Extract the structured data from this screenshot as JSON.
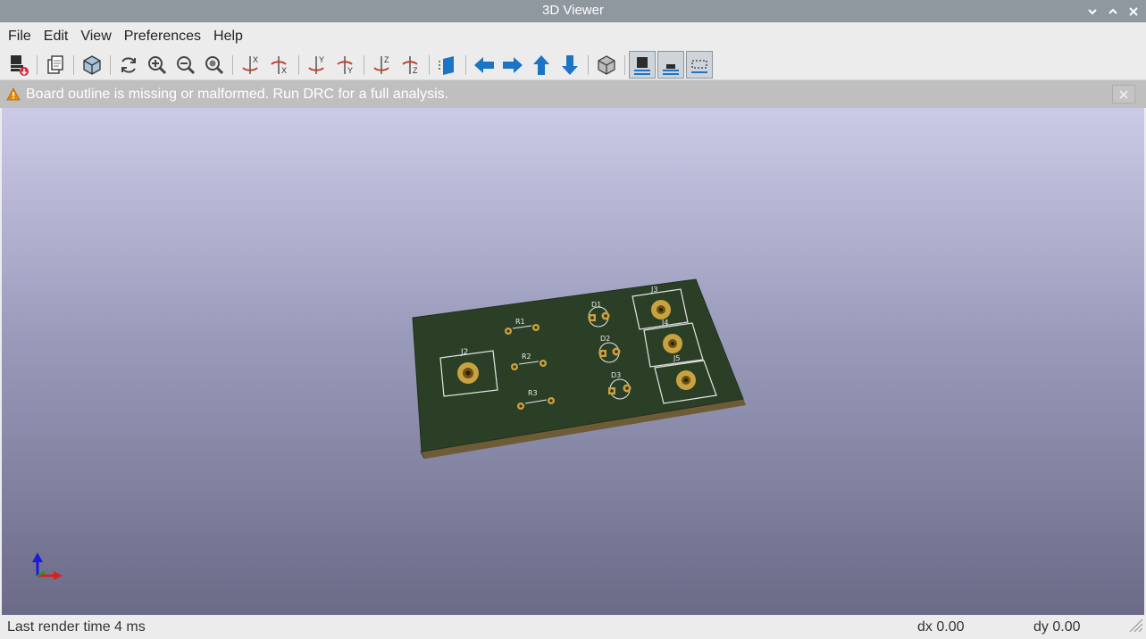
{
  "window": {
    "title": "3D Viewer"
  },
  "menu": [
    "File",
    "Edit",
    "View",
    "Preferences",
    "Help"
  ],
  "toolbar": {
    "icons": [
      "export-icon",
      "copy-icon",
      "render-options-icon",
      "reload-icon",
      "zoom-in-icon",
      "zoom-out-icon",
      "zoom-fit-icon",
      "rotate-x-cw-icon",
      "rotate-x-ccw-icon",
      "rotate-y-cw-icon",
      "rotate-y-ccw-icon",
      "rotate-z-cw-icon",
      "rotate-z-ccw-icon",
      "flip-board-icon",
      "pan-left-icon",
      "pan-right-icon",
      "pan-up-icon",
      "pan-down-icon",
      "ortho-view-icon",
      "layers-view-icon",
      "board-view-icon",
      "bounding-box-icon"
    ]
  },
  "infobar": {
    "message": "Board outline is missing or malformed. Run DRC for a full analysis."
  },
  "board": {
    "labels": [
      "J2",
      "R1",
      "R2",
      "R3",
      "D1",
      "D2",
      "D3",
      "J3",
      "J4",
      "J5"
    ]
  },
  "colors": {
    "titlebar": "#8f979f",
    "board": "#2b3f27",
    "pad": "#c8a23f",
    "accent": "#1c74c4"
  },
  "status": {
    "render_time": "Last render time 4 ms",
    "dx": "dx 0.00",
    "dy": "dy 0.00"
  }
}
